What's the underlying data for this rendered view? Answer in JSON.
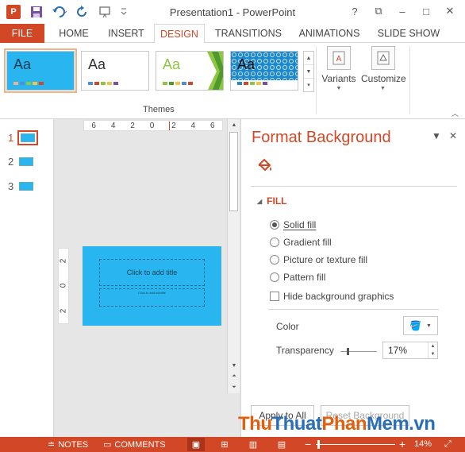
{
  "app": {
    "title": "Presentation1 - PowerPoint",
    "logo_letter": "P",
    "accent": "#d24726"
  },
  "quick_access": [
    {
      "name": "save-icon"
    },
    {
      "name": "undo-icon"
    },
    {
      "name": "redo-icon"
    },
    {
      "name": "start-from-beginning-icon"
    },
    {
      "name": "customize-qat-icon"
    }
  ],
  "window_controls": {
    "help": "?",
    "restore": "⧉",
    "minimize": "–",
    "maximize": "□",
    "close": "✕"
  },
  "tabs": [
    {
      "label": "FILE"
    },
    {
      "label": "HOME"
    },
    {
      "label": "INSERT"
    },
    {
      "label": "DESIGN",
      "active": true
    },
    {
      "label": "TRANSITIONS"
    },
    {
      "label": "ANIMATIONS"
    },
    {
      "label": "SLIDE SHOW"
    }
  ],
  "ribbon": {
    "themes_label": "Themes",
    "theme_cards": [
      {
        "label": "Aa",
        "bg": "#29b6f0",
        "fg": "#1a3d50",
        "selected": true
      },
      {
        "label": "Aa",
        "bg": "#ffffff",
        "fg": "#333333"
      },
      {
        "label": "Aa",
        "bg": "#ffffff",
        "fg": "#8dc63f"
      },
      {
        "label": "Aa",
        "bg": "#ffffff",
        "fg": "#333333"
      }
    ],
    "variants_label": "Variants",
    "customize_label": "Customize"
  },
  "thumbnails": [
    {
      "number": "1",
      "active": true
    },
    {
      "number": "2"
    },
    {
      "number": "3"
    }
  ],
  "ruler": {
    "horizontal": [
      "6",
      "4",
      "2",
      "0",
      "2",
      "4",
      "6"
    ],
    "vertical": [
      "2",
      "0",
      "2"
    ]
  },
  "slide": {
    "title_placeholder": "Click to add title",
    "subtitle_placeholder": "Click to add subtitle",
    "background": "#29b6f0"
  },
  "pane": {
    "title": "Format Background",
    "section": "FILL",
    "fill_options": [
      {
        "label": "Solid fill",
        "selected": true
      },
      {
        "label": "Gradient fill"
      },
      {
        "label": "Picture or texture fill"
      },
      {
        "label": "Pattern fill"
      }
    ],
    "hide_graphics_label": "Hide background graphics",
    "color_label": "Color",
    "transparency_label": "Transparency",
    "transparency_value": "17%",
    "transparency_fraction": 0.17,
    "apply_all_label": "Apply to All",
    "reset_label": "Reset Background"
  },
  "statusbar": {
    "notes": "NOTES",
    "comments": "COMMENTS",
    "zoom": "14%",
    "zoom_minus": "−",
    "zoom_plus": "+"
  },
  "watermark": {
    "part1": "Thu",
    "part2": "Thuat",
    "part3": "Phan",
    "part4": "Mem.vn"
  }
}
